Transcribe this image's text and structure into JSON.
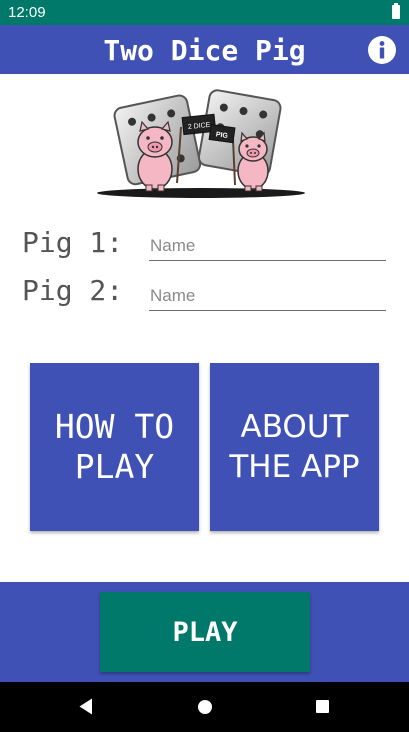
{
  "status_bar": {
    "time": "12:09"
  },
  "app_bar": {
    "title": "Two Dice Pig",
    "info_icon": "info-circle-icon"
  },
  "logo": {
    "sign_left": "2 DICE",
    "sign_right": "PIG",
    "icon": "dice-pigs-logo"
  },
  "players": [
    {
      "label": "Pig 1:",
      "placeholder": "Name",
      "value": ""
    },
    {
      "label": "Pig 2:",
      "placeholder": "Name",
      "value": ""
    }
  ],
  "buttons": {
    "how_to_play": {
      "line1": "HOW TO",
      "line2": "PLAY"
    },
    "about_app": {
      "line1": "ABOUT",
      "line2": "THE APP"
    },
    "play": "PLAY"
  },
  "colors": {
    "primary": "#3f51b5",
    "accent": "#00796b",
    "status_bar": "#00796b",
    "nav_bar": "#000000"
  },
  "nav_bar": {
    "back_icon": "back-triangle-icon",
    "home_icon": "home-circle-icon",
    "recents_icon": "recents-square-icon"
  }
}
